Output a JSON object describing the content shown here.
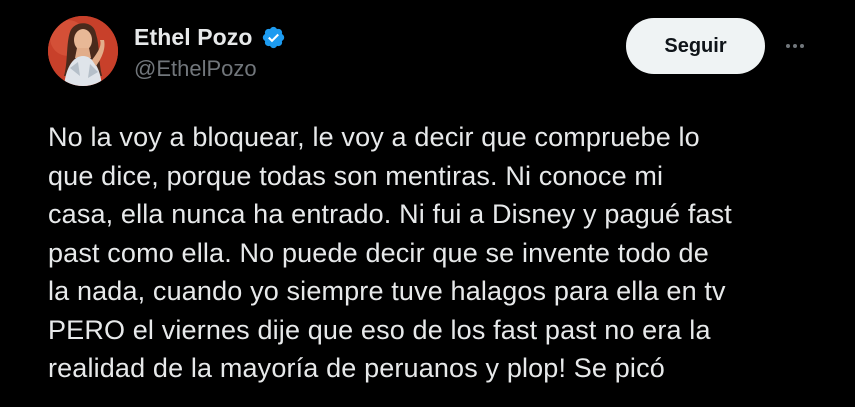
{
  "author": {
    "display_name": "Ethel Pozo",
    "handle": "@EthelPozo",
    "verified": true,
    "avatar_bg": "#c23a26"
  },
  "actions": {
    "follow_label": "Seguir",
    "more_icon": "more-horizontal-icon"
  },
  "colors": {
    "background": "#000000",
    "text_primary": "#e7e9ea",
    "text_secondary": "#71767b",
    "verified_blue": "#1d9bf0",
    "follow_bg": "#eff3f4"
  },
  "tweet": {
    "lines": [
      "No la voy a bloquear, le voy a decir que compruebe lo",
      "que dice, porque todas son mentiras. Ni conoce mi",
      "casa, ella nunca ha entrado. Ni fui a Disney y pagué fast",
      "past como ella. No puede decir que se invente todo de",
      "la nada, cuando yo siempre tuve halagos para ella en tv",
      "PERO el viernes dije que eso de los fast past no era la",
      "realidad de la mayoría de peruanos y plop! Se picó"
    ]
  }
}
